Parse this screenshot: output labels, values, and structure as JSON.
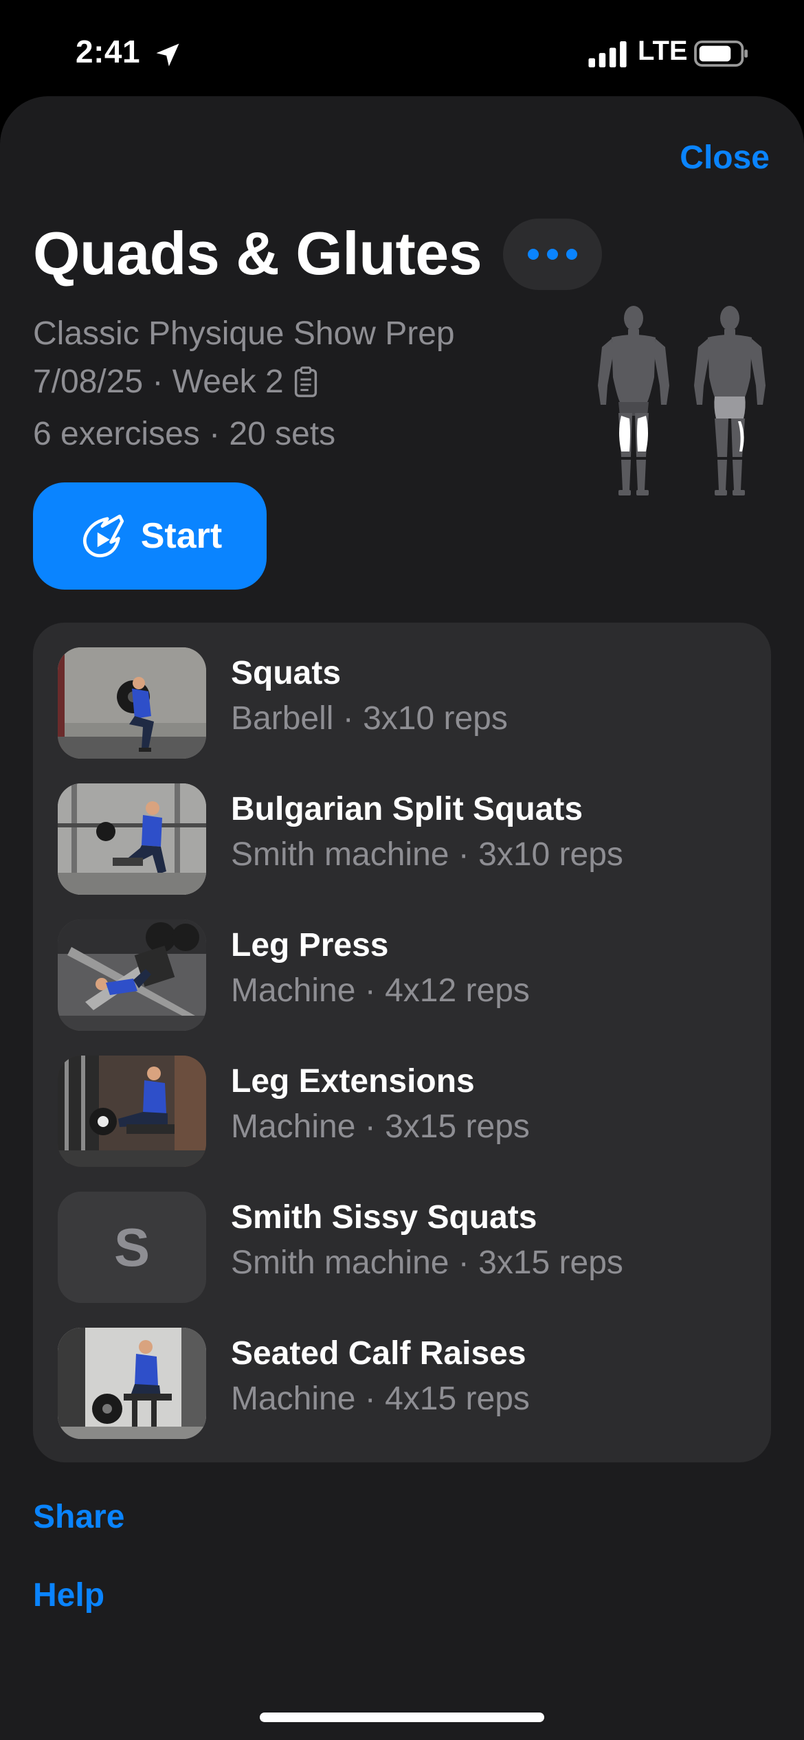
{
  "status_bar": {
    "time": "2:41",
    "network": "LTE",
    "icons": [
      "location-arrow-icon",
      "signal-icon",
      "battery-icon"
    ]
  },
  "header": {
    "close_label": "Close",
    "title": "Quads & Glutes",
    "more_icon": "ellipsis-icon"
  },
  "workout": {
    "program": "Classic Physique Show Prep",
    "date_week": "7/08/25 · Week 2",
    "summary": "6 exercises · 20 sets",
    "notes_icon": "clipboard-icon"
  },
  "start_button": {
    "label": "Start",
    "icon": "comet-play-icon"
  },
  "exercises": [
    {
      "name": "Squats",
      "detail": "Barbell · 3x10 reps",
      "thumb": "photo"
    },
    {
      "name": "Bulgarian Split Squats",
      "detail": "Smith machine · 3x10 reps",
      "thumb": "photo"
    },
    {
      "name": "Leg Press",
      "detail": "Machine · 4x12 reps",
      "thumb": "photo"
    },
    {
      "name": "Leg Extensions",
      "detail": "Machine · 3x15 reps",
      "thumb": "photo"
    },
    {
      "name": "Smith Sissy Squats",
      "detail": "Smith machine · 3x15 reps",
      "thumb": "letter",
      "letter": "S"
    },
    {
      "name": "Seated Calf Raises",
      "detail": "Machine · 4x15 reps",
      "thumb": "photo"
    }
  ],
  "footer": {
    "share_label": "Share",
    "help_label": "Help"
  },
  "colors": {
    "accent": "#0a84ff",
    "sheet_bg": "#1c1c1e",
    "card_bg": "#2c2c2e",
    "secondary_text": "#8e8e93"
  }
}
